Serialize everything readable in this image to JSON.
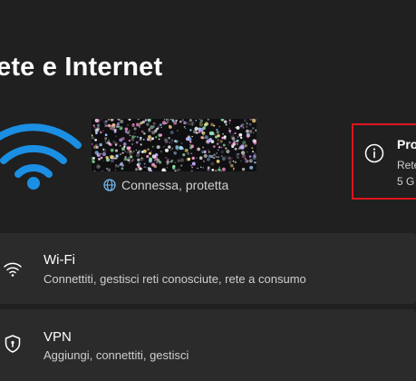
{
  "header": {
    "title": "ete e Internet"
  },
  "network": {
    "status_text": "Connessa, protetta",
    "wifi_icon": "wifi-large-icon",
    "status_icon": "globe-icon"
  },
  "properties_card": {
    "title": "Pro",
    "line1": "Rete",
    "line2": "5 G",
    "icon": "info-icon",
    "highlight_color": "#e0141e"
  },
  "rows": [
    {
      "label": "Wi-Fi",
      "description": "Connettiti, gestisci reti conosciute, rete a consumo",
      "icon": "wifi-icon"
    },
    {
      "label": "VPN",
      "description": "Aggiungi, connettiti, gestisci",
      "icon": "shield-icon"
    }
  ],
  "colors": {
    "background": "#202020",
    "row_background": "#2b2b2b",
    "accent": "#1a8fe3"
  }
}
